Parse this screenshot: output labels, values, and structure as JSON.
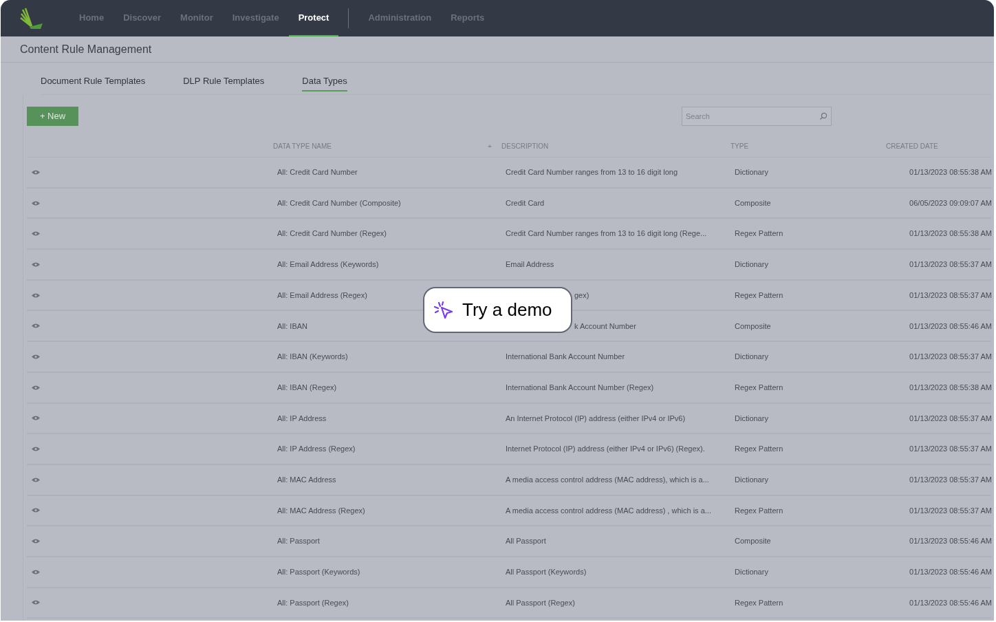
{
  "nav": {
    "items": [
      {
        "label": "Home",
        "selected": false
      },
      {
        "label": "Discover",
        "selected": false
      },
      {
        "label": "Monitor",
        "selected": false
      },
      {
        "label": "Investigate",
        "selected": false
      },
      {
        "label": "Protect",
        "selected": true
      }
    ],
    "secondary_items": [
      {
        "label": "Administration",
        "selected": false
      },
      {
        "label": "Reports",
        "selected": false
      }
    ]
  },
  "page_title": "Content Rule Management",
  "tabs": [
    {
      "label": "Document Rule Templates",
      "selected": false
    },
    {
      "label": "DLP Rule Templates",
      "selected": false
    },
    {
      "label": "Data Types",
      "selected": true
    }
  ],
  "new_button": "+ New",
  "search": {
    "placeholder": "Search"
  },
  "table": {
    "columns": [
      "DATA TYPE NAME",
      "DESCRIPTION",
      "TYPE",
      "CREATED DATE"
    ],
    "rows": [
      {
        "name": "All: Credit Card Number",
        "description": "Credit Card Number ranges from 13 to 16 digit long",
        "type": "Dictionary",
        "created": "01/13/2023 08:55:38 AM"
      },
      {
        "name": "All: Credit Card Number (Composite)",
        "description": "Credit Card",
        "type": "Composite",
        "created": "06/05/2023 09:09:07 AM"
      },
      {
        "name": "All: Credit Card Number (Regex)",
        "description": "Credit Card Number ranges from 13 to 16 digit long (Rege...",
        "type": "Regex Pattern",
        "created": "01/13/2023 08:55:38 AM"
      },
      {
        "name": "All: Email Address (Keywords)",
        "description": "Email Address",
        "type": "Dictionary",
        "created": "01/13/2023 08:55:37 AM"
      },
      {
        "name": "All: Email Address (Regex)",
        "description": "gex)",
        "covered": true,
        "type": "Regex Pattern",
        "created": "01/13/2023 08:55:37 AM"
      },
      {
        "name": "All: IBAN",
        "description": "k Account Number",
        "covered": true,
        "type": "Composite",
        "created": "01/13/2023 08:55:46 AM"
      },
      {
        "name": "All: IBAN (Keywords)",
        "description": "International Bank Account Number",
        "type": "Dictionary",
        "created": "01/13/2023 08:55:37 AM"
      },
      {
        "name": "All: IBAN (Regex)",
        "description": "International Bank Account Number (Regex)",
        "type": "Regex Pattern",
        "created": "01/13/2023 08:55:38 AM"
      },
      {
        "name": "All: IP Address",
        "description": "An Internet Protocol (IP) address (either IPv4 or IPv6)",
        "type": "Dictionary",
        "created": "01/13/2023 08:55:37 AM"
      },
      {
        "name": "All: IP Address (Regex)",
        "description": "Internet Protocol (IP) address (either IPv4 or IPv6) (Regex).",
        "type": "Regex Pattern",
        "created": "01/13/2023 08:55:37 AM"
      },
      {
        "name": "All: MAC Address",
        "description": "A media access control address (MAC address), which is a...",
        "type": "Dictionary",
        "created": "01/13/2023 08:55:37 AM"
      },
      {
        "name": "All: MAC Address (Regex)",
        "description": "A media access control address (MAC address) , which is a...",
        "type": "Regex Pattern",
        "created": "01/13/2023 08:55:37 AM"
      },
      {
        "name": "All: Passport",
        "description": "All Passport",
        "type": "Composite",
        "created": "01/13/2023 08:55:46 AM"
      },
      {
        "name": "All: Passport (Keywords)",
        "description": "All Passport (Keywords)",
        "type": "Dictionary",
        "created": "01/13/2023 08:55:46 AM"
      },
      {
        "name": "All: Passport (Regex)",
        "description": "All Passport (Regex)",
        "type": "Regex Pattern",
        "created": "01/13/2023 08:55:46 AM"
      }
    ]
  },
  "demo_button": "Try a demo"
}
